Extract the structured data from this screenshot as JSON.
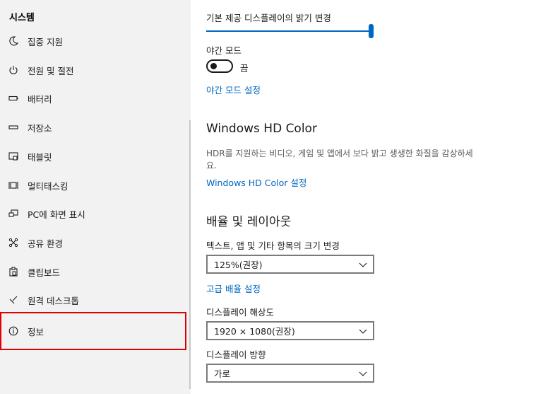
{
  "sidebar": {
    "title": "시스템",
    "items": [
      {
        "label": "집중 지원",
        "icon": "moon-icon"
      },
      {
        "label": "전원 및 절전",
        "icon": "power-icon"
      },
      {
        "label": "배터리",
        "icon": "battery-icon"
      },
      {
        "label": "저장소",
        "icon": "storage-icon"
      },
      {
        "label": "태블릿",
        "icon": "tablet-icon"
      },
      {
        "label": "멀티태스킹",
        "icon": "multitasking-icon"
      },
      {
        "label": "PC에 화면 표시",
        "icon": "project-icon"
      },
      {
        "label": "공유 환경",
        "icon": "share-icon"
      },
      {
        "label": "클립보드",
        "icon": "clipboard-icon"
      },
      {
        "label": "원격 데스크톱",
        "icon": "remote-desktop-icon"
      },
      {
        "label": "정보",
        "icon": "info-icon"
      }
    ],
    "selected": "정보"
  },
  "main": {
    "brightness_label": "기본 제공 디스플레이의 밝기 변경",
    "brightness_value": 1.0,
    "night_light_label": "야간 모드",
    "night_light_state": "끔",
    "night_light_settings_link": "야간 모드 설정",
    "hdr_heading": "Windows HD Color",
    "hdr_description": "HDR를 지원하는 비디오, 게임 및 앱에서 보다 밝고 생생한 화질을 감상하세요.",
    "hdr_settings_link": "Windows HD Color 설정",
    "scale_heading": "배율 및 레이아웃",
    "scale_label": "텍스트, 앱 및 기타 항목의 크기 변경",
    "scale_value": "125%(권장)",
    "advanced_scaling_link": "고급 배율 설정",
    "resolution_label": "디스플레이 해상도",
    "resolution_value": "1920 × 1080(권장)",
    "orientation_label": "디스플레이 방향",
    "orientation_value": "가로"
  },
  "colors": {
    "accent": "#0067c0",
    "selection_outline": "#e00000",
    "sidebar_bg": "#f2f2f2"
  }
}
